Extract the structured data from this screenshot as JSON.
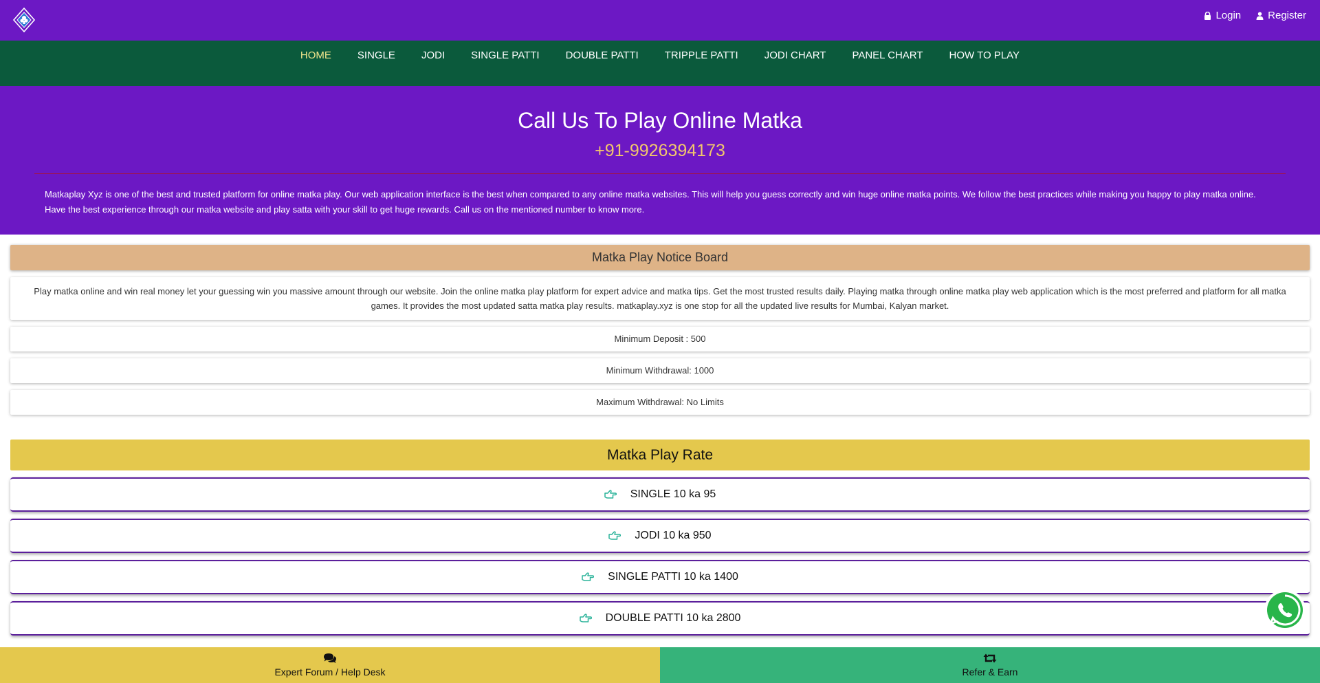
{
  "header": {
    "logo_icon": "diamond-logo-icon",
    "login_label": "Login",
    "register_label": "Register"
  },
  "nav": {
    "items": [
      "HOME",
      "SINGLE",
      "JODI",
      "SINGLE PATTI",
      "DOUBLE PATTI",
      "TRIPPLE PATTI",
      "JODI CHART",
      "PANEL CHART",
      "HOW TO PLAY"
    ],
    "active": "HOME"
  },
  "hero": {
    "title": "Call Us To Play Online Matka",
    "phone": "+91-9926394173",
    "description": "Matkaplay Xyz is one of the best and trusted platform for online matka play. Our web application interface is the best when compared to any online matka websites. This will help you guess correctly and win huge online matka points. We follow the best practices while making you happy to play matka online. Have the best experience through our matka website and play satta with your skill to get huge rewards. Call us on the mentioned number to know more."
  },
  "notice": {
    "title": "Matka Play Notice Board",
    "text": "Play matka online and win real money let your guessing win you massive amount through our website. Join the online matka play platform for expert advice and matka tips. Get the most trusted results daily. Playing matka through online matka play web application which is the most preferred and platform for all matka games. It provides the most updated satta matka play results. matkaplay.xyz is one stop for all the updated live results for Mumbai, Kalyan market.",
    "min_deposit": "Minimum Deposit : 500",
    "min_withdrawal": "Minimum Withdrawal:  1000",
    "max_withdrawal": "Maximum Withdrawal: No Limits"
  },
  "rates": {
    "title": "Matka Play Rate",
    "items": [
      "SINGLE 10 ka 95",
      "JODI 10 ka 950",
      "SINGLE PATTI 10 ka 1400",
      "DOUBLE PATTI 10 ka 2800"
    ]
  },
  "bottom": {
    "left_label": "Expert Forum / Help Desk",
    "right_label": "Refer & Earn"
  },
  "colors": {
    "purple": "#6c18c4",
    "green_nav": "#0b5a3c",
    "gold": "#e4c84d",
    "tan": "#deb387",
    "green_button": "#36b37a",
    "phone": "#f2c76b",
    "nav_active": "#f1e58c"
  }
}
